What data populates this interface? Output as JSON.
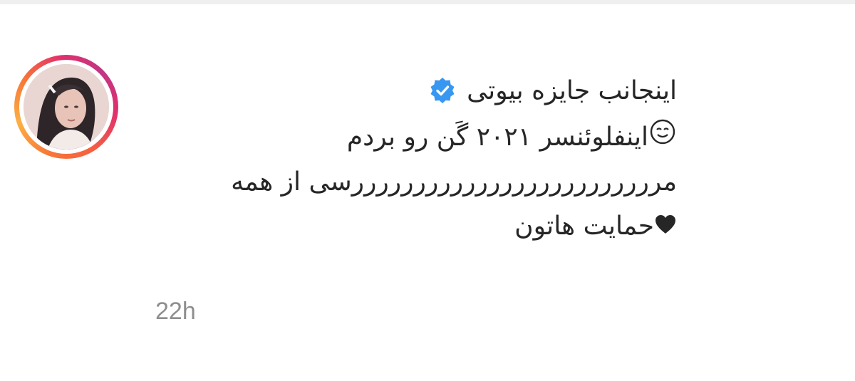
{
  "comment": {
    "username": "اینجانب جایزه بیوتی",
    "lines": [
      "اینفلوئنسر ۲۰۲۱ گَن رو بردم",
      "مرررررررررررررررررررررررررسی از همه",
      "حمایت هاتون"
    ],
    "timestamp": "22h"
  },
  "icons": {
    "verified": "verified-badge-icon",
    "smile": "smiling-face-icon",
    "heart": "black-heart-icon"
  },
  "colors": {
    "text": "#262626",
    "muted": "#8e8e8e",
    "verified_blue": "#3897f0"
  }
}
